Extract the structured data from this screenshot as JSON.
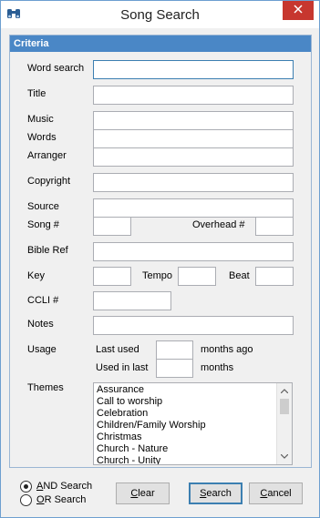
{
  "window": {
    "title": "Song Search"
  },
  "criteria": {
    "header": "Criteria",
    "word_search": {
      "label": "Word search",
      "value": ""
    },
    "title": {
      "label": "Title",
      "value": ""
    },
    "music": {
      "label": "Music",
      "value": ""
    },
    "words": {
      "label": "Words",
      "value": ""
    },
    "arranger": {
      "label": "Arranger",
      "value": ""
    },
    "copyright": {
      "label": "Copyright",
      "value": ""
    },
    "source": {
      "label": "Source",
      "value": ""
    },
    "song_num": {
      "label": "Song #",
      "value": ""
    },
    "overhead_num": {
      "label": "Overhead #",
      "value": ""
    },
    "bible_ref": {
      "label": "Bible Ref",
      "value": ""
    },
    "key": {
      "label": "Key",
      "value": ""
    },
    "tempo": {
      "label": "Tempo",
      "value": ""
    },
    "beat": {
      "label": "Beat",
      "value": ""
    },
    "ccli": {
      "label": "CCLI #",
      "value": ""
    },
    "notes": {
      "label": "Notes",
      "value": ""
    },
    "usage": {
      "label": "Usage",
      "last_used_label": "Last used",
      "last_used_value": "",
      "months_ago_label": "months ago",
      "used_in_last_label": "Used in last",
      "used_in_last_value": "",
      "months_label": "months"
    },
    "themes": {
      "label": "Themes",
      "items": [
        "Assurance",
        "Call to worship",
        "Celebration",
        "Children/Family Worship",
        "Christmas",
        "Church - Nature",
        "Church - Unity"
      ]
    }
  },
  "footer": {
    "and_search": {
      "label_prefix": "",
      "accel": "A",
      "label_rest": "ND Search",
      "selected": true
    },
    "or_search": {
      "accel": "O",
      "label_rest": "R Search",
      "selected": false
    },
    "clear": {
      "accel": "C",
      "rest": "lear"
    },
    "search": {
      "accel": "S",
      "rest": "earch"
    },
    "cancel": {
      "accel": "C",
      "rest": "ancel"
    }
  },
  "icons": {
    "app": "binoculars-icon",
    "close": "close-icon",
    "scroll_up": "chevron-up-icon",
    "scroll_down": "chevron-down-icon"
  },
  "colors": {
    "header_bg": "#4a87c6",
    "close_bg": "#c7372f",
    "focus_border": "#3c7fb1"
  }
}
